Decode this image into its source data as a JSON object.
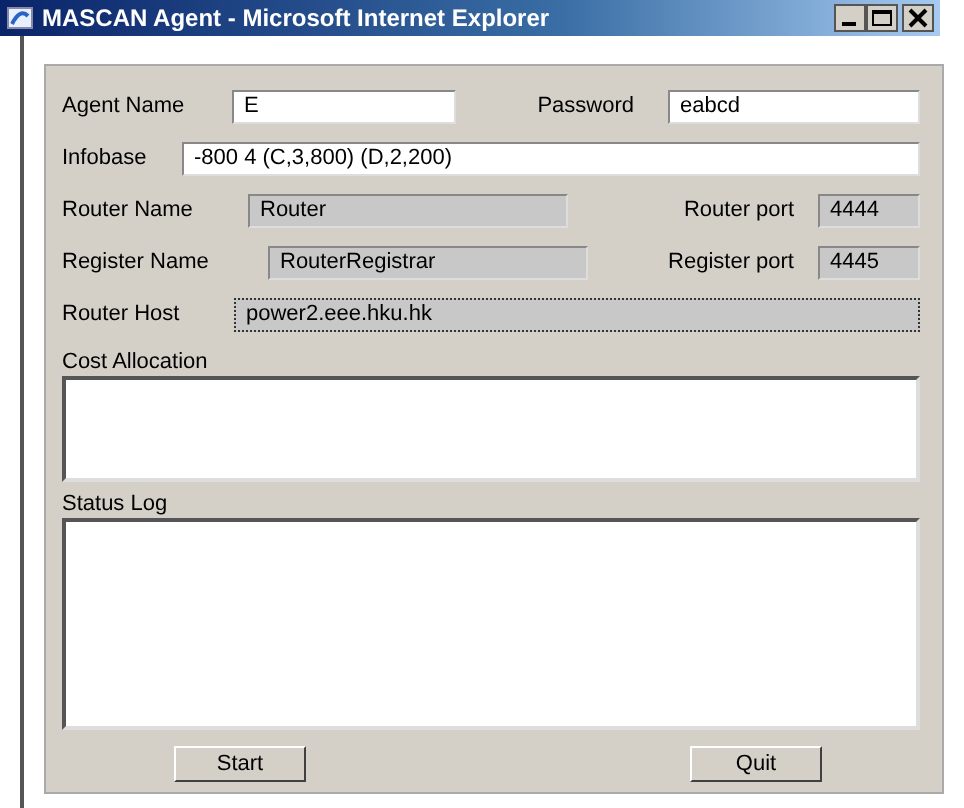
{
  "window": {
    "title": "MASCAN Agent - Microsoft Internet Explorer"
  },
  "rows": [
    {
      "fields": [
        {
          "label": "Agent Name",
          "value": "E",
          "disabled": false,
          "focused": false
        },
        {
          "label": "Password",
          "value": "eabcd",
          "disabled": false,
          "focused": false
        }
      ]
    },
    {
      "fields": [
        {
          "label": "Infobase",
          "value": "-800 4 (C,3,800) (D,2,200)",
          "disabled": false,
          "focused": false
        }
      ]
    },
    {
      "fields": [
        {
          "label": "Router Name",
          "value": "Router",
          "disabled": true,
          "focused": false
        },
        {
          "label": "Router port",
          "value": "4444",
          "disabled": true,
          "focused": false
        }
      ]
    },
    {
      "fields": [
        {
          "label": "Register Name",
          "value": "RouterRegistrar",
          "disabled": true,
          "focused": false
        },
        {
          "label": "Register port",
          "value": "4445",
          "disabled": true,
          "focused": false
        }
      ]
    },
    {
      "fields": [
        {
          "label": "Router Host",
          "value": "power2.eee.hku.hk",
          "disabled": true,
          "focused": true
        }
      ]
    }
  ],
  "areas": [
    {
      "label": "Cost Allocation"
    },
    {
      "label": "Status Log"
    }
  ],
  "buttons": [
    {
      "label": "Start"
    },
    {
      "label": "Quit"
    }
  ]
}
